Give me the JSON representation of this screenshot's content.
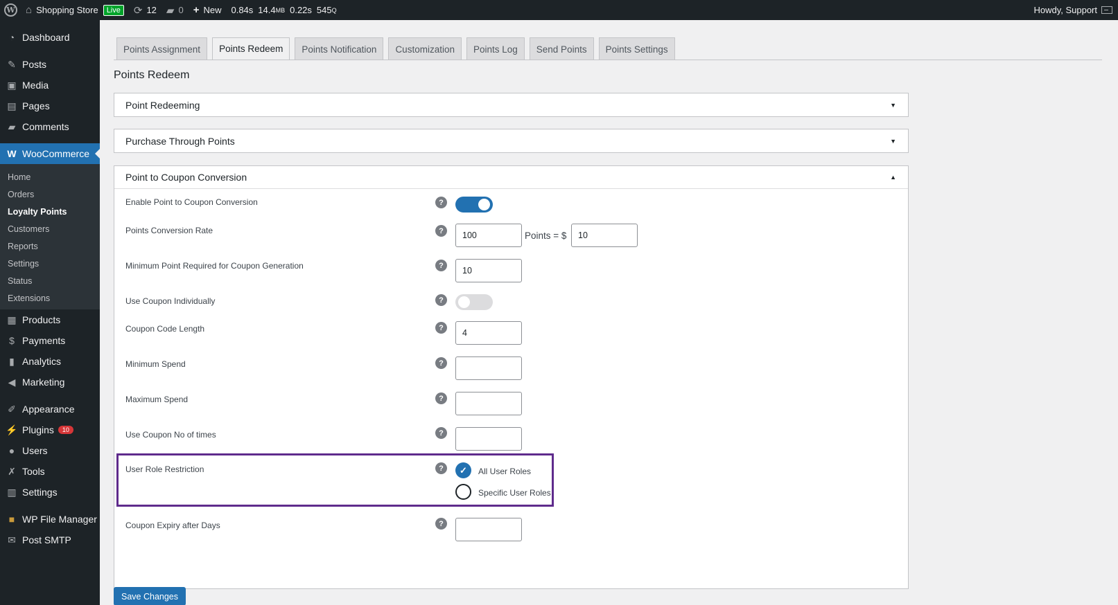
{
  "adminbar": {
    "site_name": "Shopping Store",
    "live_badge": "Live",
    "updates_count": "12",
    "comments_count": "0",
    "new_label": "New",
    "stat_time": "0.84s",
    "stat_memory": "14.4",
    "stat_memory_unit": "MB",
    "stat_query_time": "0.22s",
    "stat_queries": "545",
    "stat_queries_unit": "Q",
    "howdy": "Howdy, Support"
  },
  "sidebar": {
    "dashboard": "Dashboard",
    "posts": "Posts",
    "media": "Media",
    "pages": "Pages",
    "comments": "Comments",
    "woocommerce": "WooCommerce",
    "woo_sub": [
      "Home",
      "Orders",
      "Loyalty Points",
      "Customers",
      "Reports",
      "Settings",
      "Status",
      "Extensions"
    ],
    "products": "Products",
    "payments": "Payments",
    "analytics": "Analytics",
    "marketing": "Marketing",
    "appearance": "Appearance",
    "plugins": "Plugins",
    "plugins_badge": "10",
    "users": "Users",
    "tools": "Tools",
    "settings": "Settings",
    "file_manager": "WP File Manager",
    "post_smtp": "Post SMTP"
  },
  "tabs": [
    "Points Assignment",
    "Points Redeem",
    "Points Notification",
    "Customization",
    "Points Log",
    "Send Points",
    "Points Settings"
  ],
  "page_title": "Points Redeem",
  "panels": {
    "point_redeeming": "Point Redeeming",
    "purchase_through_points": "Purchase Through Points",
    "point_to_coupon": "Point to Coupon Conversion"
  },
  "form": {
    "enable_label": "Enable Point to Coupon Conversion",
    "enable_value": true,
    "rate_label": "Points Conversion Rate",
    "rate_points": "100",
    "rate_mid_text": "Points = $",
    "rate_amount": "10",
    "min_points_label": "Minimum Point Required for Coupon Generation",
    "min_points_value": "10",
    "individual_label": "Use Coupon Individually",
    "individual_value": false,
    "code_length_label": "Coupon Code Length",
    "code_length_value": "4",
    "min_spend_label": "Minimum Spend",
    "min_spend_value": "",
    "max_spend_label": "Maximum Spend",
    "max_spend_value": "",
    "use_times_label": "Use Coupon No of times",
    "use_times_value": "",
    "role_label": "User Role Restriction",
    "role_option_all": "All User Roles",
    "role_option_specific": "Specific User Roles",
    "role_selected": "All User Roles",
    "expiry_label": "Coupon Expiry after Days",
    "expiry_value": "",
    "help_glyph": "?"
  },
  "save_label": "Save Changes",
  "colors": {
    "accent": "#2271b1",
    "highlight_border": "#5f2b8c",
    "sidebar_bg": "#1d2327"
  }
}
